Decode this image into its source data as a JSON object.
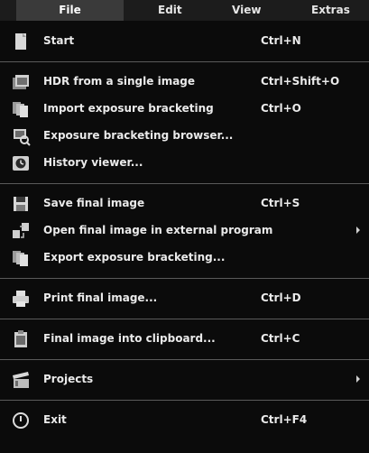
{
  "menubar": {
    "file": "File",
    "edit": "Edit",
    "view": "View",
    "extras": "Extras"
  },
  "menu": {
    "start": {
      "label": "Start",
      "shortcut": "Ctrl+N"
    },
    "hdr_single": {
      "label": "HDR from a single image",
      "shortcut": "Ctrl+Shift+O"
    },
    "import_bracketing": {
      "label": "Import exposure bracketing",
      "shortcut": "Ctrl+O"
    },
    "bracketing_browser": {
      "label": "Exposure bracketing browser..."
    },
    "history_viewer": {
      "label": "History viewer..."
    },
    "save_final": {
      "label": "Save final image",
      "shortcut": "Ctrl+S"
    },
    "open_external": {
      "label": "Open final image in external program"
    },
    "export_bracketing": {
      "label": "Export exposure bracketing..."
    },
    "print_final": {
      "label": "Print final image...",
      "shortcut": "Ctrl+D"
    },
    "clipboard": {
      "label": "Final image into clipboard...",
      "shortcut": "Ctrl+C"
    },
    "projects": {
      "label": "Projects"
    },
    "exit": {
      "label": "Exit",
      "shortcut": "Ctrl+F4"
    }
  }
}
